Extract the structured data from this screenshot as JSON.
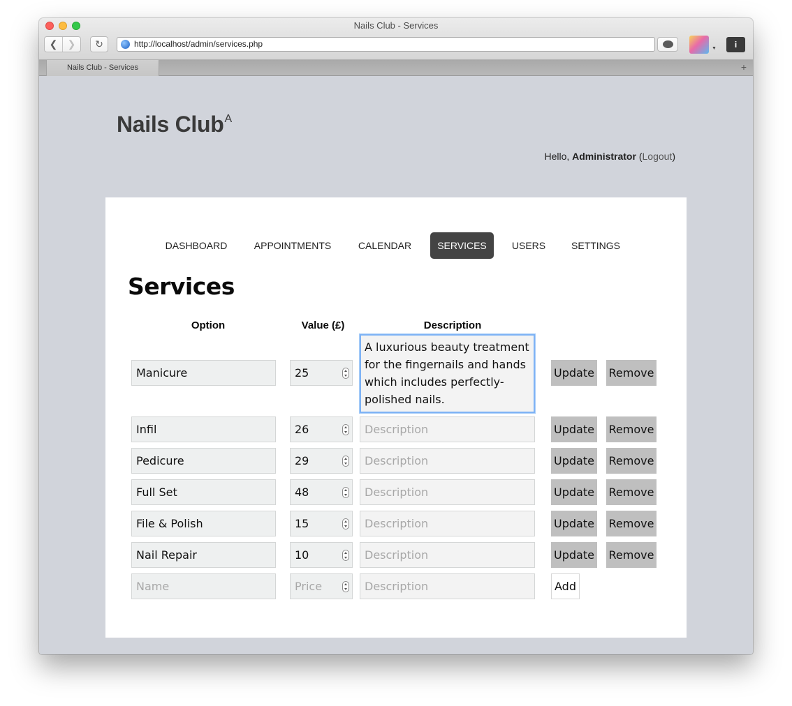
{
  "browser": {
    "window_title": "Nails Club - Services",
    "url": "http://localhost/admin/services.php",
    "tab_title": "Nails Club - Services",
    "new_tab_symbol": "+"
  },
  "site": {
    "brand": "Nails Club",
    "brand_sup": "A",
    "greeting_prefix": "Hello, ",
    "user_name": "Administrator",
    "logout_open": " (",
    "logout_label": "Logout",
    "logout_close": ")"
  },
  "nav": {
    "items": [
      {
        "label": "DASHBOARD",
        "active": false
      },
      {
        "label": "APPOINTMENTS",
        "active": false
      },
      {
        "label": "CALENDAR",
        "active": false
      },
      {
        "label": "SERVICES",
        "active": true
      },
      {
        "label": "USERS",
        "active": false
      },
      {
        "label": "SETTINGS",
        "active": false
      }
    ]
  },
  "services": {
    "title": "Services",
    "columns": {
      "option": "Option",
      "value": "Value (£)",
      "description": "Description"
    },
    "update_label": "Update",
    "remove_label": "Remove",
    "desc_placeholder": "Description",
    "rows": [
      {
        "name": "Manicure",
        "value": "25",
        "description": "A luxurious beauty treatment for the fingernails and hands which includes perfectly-polished nails."
      },
      {
        "name": "Infil",
        "value": "26",
        "description": ""
      },
      {
        "name": "Pedicure",
        "value": "29",
        "description": ""
      },
      {
        "name": "Full Set",
        "value": "48",
        "description": ""
      },
      {
        "name": "File & Polish",
        "value": "15",
        "description": ""
      },
      {
        "name": "Nail Repair",
        "value": "10",
        "description": ""
      }
    ],
    "new_row": {
      "name_placeholder": "Name",
      "price_placeholder": "Price",
      "description_placeholder": "Description",
      "add_label": "Add"
    }
  },
  "colors": {
    "page_bg": "#d1d4db",
    "active_nav_bg": "#444444",
    "button_bg": "#bfbfbf",
    "focus_ring": "#7eb3f5"
  }
}
